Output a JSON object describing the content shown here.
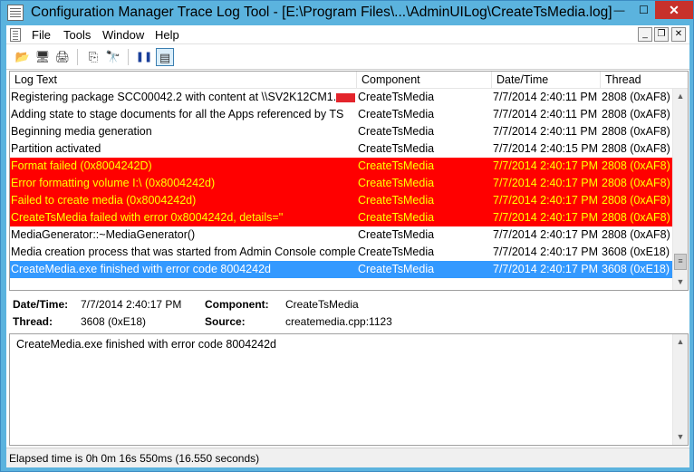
{
  "window": {
    "title": "Configuration Manager Trace Log Tool - [E:\\Program Files\\...\\AdminUILog\\CreateTsMedia.log]",
    "min_glyph": "—",
    "max_glyph": "☐",
    "close_glyph": "✕"
  },
  "menu": {
    "items": [
      "File",
      "Tools",
      "Window",
      "Help"
    ],
    "mdi_min": "_",
    "mdi_restore": "❐",
    "mdi_close": "✕"
  },
  "toolbar": {
    "open_glyph": "📂",
    "print_preview_glyph": "🖥",
    "print_glyph": "🖨",
    "copy_glyph": "⎘",
    "find_glyph": "🔭",
    "pause_glyph": "❚❚",
    "highlight_glyph": "▤"
  },
  "list": {
    "columns": [
      "Log Text",
      "Component",
      "Date/Time",
      "Thread"
    ],
    "rows": [
      {
        "text": "Registering package SCC00042.2 with content at \\\\SV2K12CM1.",
        "redacted": true,
        "component": "CreateTsMedia",
        "datetime": "7/7/2014 2:40:11 PM",
        "thread": "2808 (0xAF8)",
        "state": "normal"
      },
      {
        "text": "Adding state to stage documents for all the Apps referenced by TS",
        "component": "CreateTsMedia",
        "datetime": "7/7/2014 2:40:11 PM",
        "thread": "2808 (0xAF8)",
        "state": "normal"
      },
      {
        "text": "Beginning media generation",
        "component": "CreateTsMedia",
        "datetime": "7/7/2014 2:40:11 PM",
        "thread": "2808 (0xAF8)",
        "state": "normal"
      },
      {
        "text": "Partition activated",
        "component": "CreateTsMedia",
        "datetime": "7/7/2014 2:40:15 PM",
        "thread": "2808 (0xAF8)",
        "state": "normal"
      },
      {
        "text": "Format failed (0x8004242D)",
        "component": "CreateTsMedia",
        "datetime": "7/7/2014 2:40:17 PM",
        "thread": "2808 (0xAF8)",
        "state": "error"
      },
      {
        "text": "Error formatting volume I:\\ (0x8004242d)",
        "component": "CreateTsMedia",
        "datetime": "7/7/2014 2:40:17 PM",
        "thread": "2808 (0xAF8)",
        "state": "error"
      },
      {
        "text": "Failed to create media (0x8004242d)",
        "component": "CreateTsMedia",
        "datetime": "7/7/2014 2:40:17 PM",
        "thread": "2808 (0xAF8)",
        "state": "error"
      },
      {
        "text": "CreateTsMedia failed with error 0x8004242d, details=''",
        "component": "CreateTsMedia",
        "datetime": "7/7/2014 2:40:17 PM",
        "thread": "2808 (0xAF8)",
        "state": "error"
      },
      {
        "text": "MediaGenerator::~MediaGenerator()",
        "component": "CreateTsMedia",
        "datetime": "7/7/2014 2:40:17 PM",
        "thread": "2808 (0xAF8)",
        "state": "normal"
      },
      {
        "text": "Media creation process that was started from Admin Console comple...",
        "component": "CreateTsMedia",
        "datetime": "7/7/2014 2:40:17 PM",
        "thread": "3608 (0xE18)",
        "state": "normal"
      },
      {
        "text": "CreateMedia.exe finished with error code 8004242d",
        "component": "CreateTsMedia",
        "datetime": "7/7/2014 2:40:17 PM",
        "thread": "3608 (0xE18)",
        "state": "selected"
      }
    ],
    "scroll_up": "▲",
    "scroll_down": "▼",
    "scroll_thumb": "≡"
  },
  "details": {
    "datetime_label": "Date/Time:",
    "datetime_value": "7/7/2014 2:40:17 PM",
    "component_label": "Component:",
    "component_value": "CreateTsMedia",
    "thread_label": "Thread:",
    "thread_value": "3608 (0xE18)",
    "source_label": "Source:",
    "source_value": "createmedia.cpp:1123"
  },
  "detail_text": {
    "content": "CreateMedia.exe finished with error code 8004242d"
  },
  "status": {
    "text": "Elapsed time is 0h 0m 16s 550ms (16.550 seconds)"
  }
}
